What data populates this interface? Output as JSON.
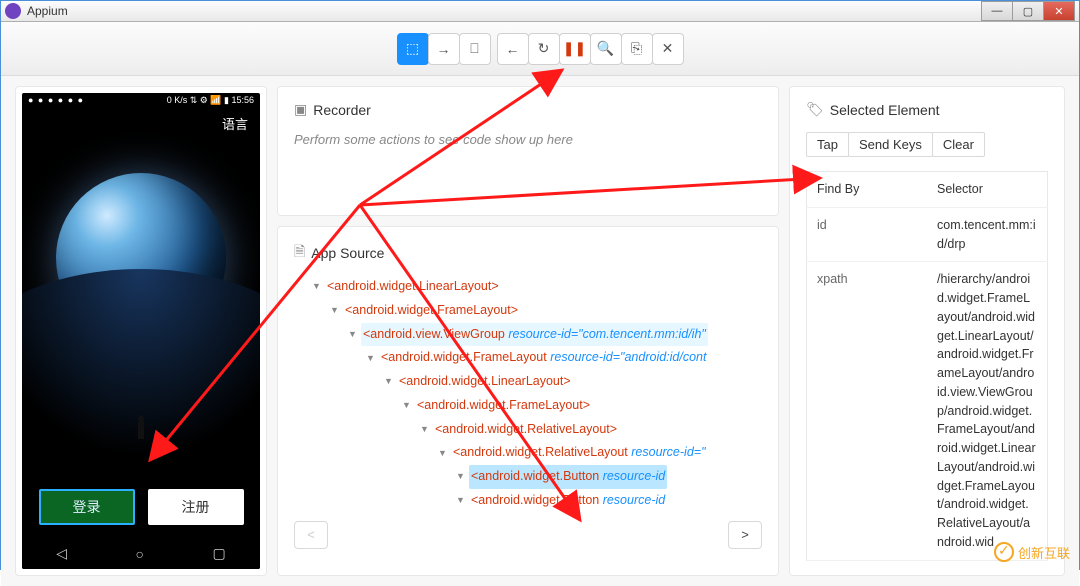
{
  "titlebar": {
    "title": "Appium"
  },
  "device": {
    "status_left": "● ● ● ● ● ●",
    "status_right": "0 K/s ⇅ ⚙ 📶 ▮ 15:56",
    "language_label": "语言",
    "login_label": "登录",
    "register_label": "注册",
    "nav_back": "◁",
    "nav_home": "○",
    "nav_recent": "▢"
  },
  "toolbar": {
    "select": "⬚",
    "swipe": "→",
    "tap": "⎕",
    "back": "←",
    "refresh": "↻",
    "pause": "❚❚",
    "search": "🔍",
    "copy": "⎘",
    "close": "✕"
  },
  "recorder": {
    "title": "Recorder",
    "hint": "Perform some actions to see code show up here"
  },
  "appsource": {
    "title": "App Source",
    "rows": [
      {
        "pad": 0,
        "text": "<android.widget.LinearLayout>"
      },
      {
        "pad": 1,
        "text": "<android.widget.FrameLayout>"
      },
      {
        "pad": 2,
        "text": "<android.view.ViewGroup",
        "attr": " resource-id=\"com.tencent.mm:id/ih\"",
        "hov": true
      },
      {
        "pad": 3,
        "text": "<android.widget.FrameLayout",
        "attr": " resource-id=\"android:id/cont"
      },
      {
        "pad": 4,
        "text": "<android.widget.LinearLayout>"
      },
      {
        "pad": 5,
        "text": "<android.widget.FrameLayout>"
      },
      {
        "pad": 6,
        "text": "<android.widget.RelativeLayout>"
      },
      {
        "pad": 7,
        "text": "<android.widget.RelativeLayout",
        "attr": " resource-id=\""
      },
      {
        "pad": 8,
        "text": "<android.widget.Button",
        "attr": " resource-id",
        "sel": true
      },
      {
        "pad": 8,
        "text": "<android.widget.Button",
        "attr": " resource-id"
      }
    ],
    "prev": "<",
    "next": ">"
  },
  "selected": {
    "title": "Selected Element",
    "tap": "Tap",
    "sendkeys": "Send Keys",
    "clear": "Clear",
    "header_findby": "Find By",
    "header_selector": "Selector",
    "rows": [
      {
        "k": "id",
        "v": "com.tencent.mm:id/drp"
      },
      {
        "k": "xpath",
        "v": "/hierarchy/android.widget.FrameLayout/android.widget.LinearLayout/android.widget.FrameLayout/android.view.ViewGroup/android.widget.FrameLayout/android.widget.LinearLayout/android.widget.FrameLayout/android.widget.RelativeLayout/android.wid"
      }
    ]
  },
  "watermark": "创新互联"
}
